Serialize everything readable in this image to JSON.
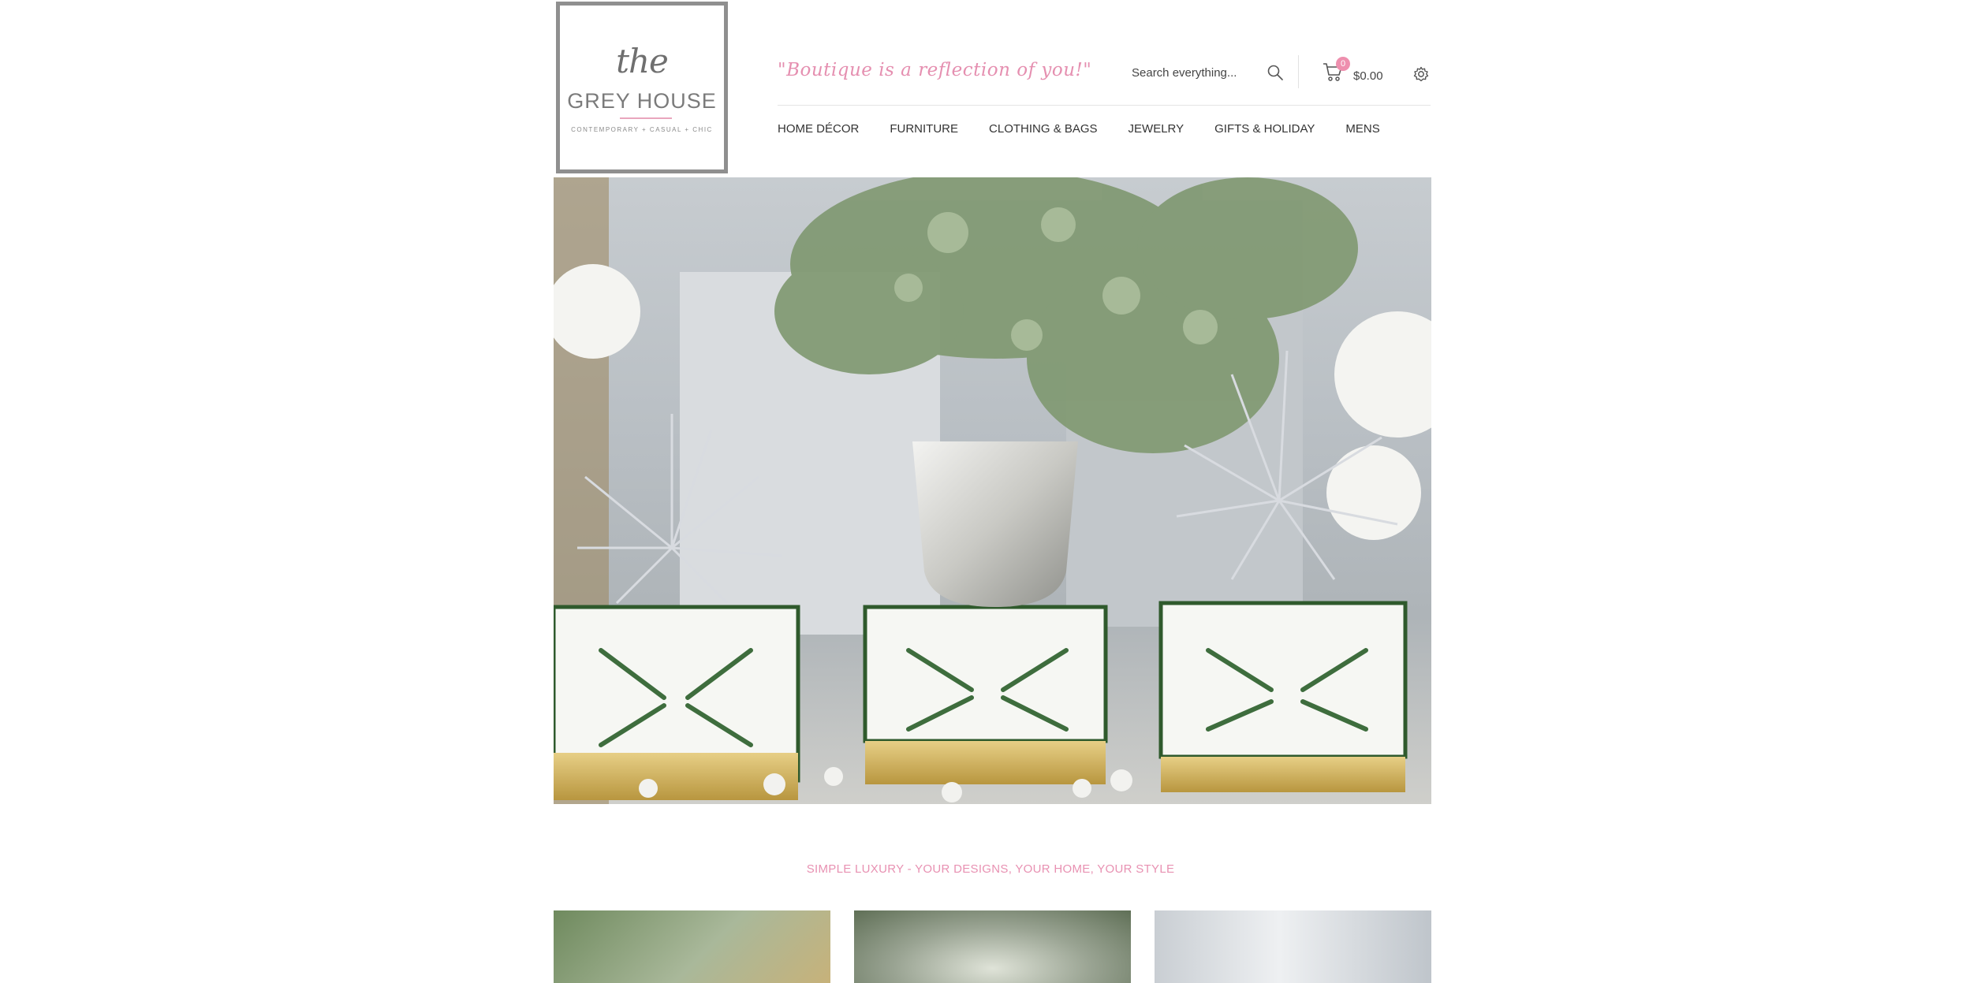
{
  "brand": {
    "the": "the",
    "name": "GREY HOUSE",
    "sub": "CONTEMPORARY + CASUAL + CHIC"
  },
  "tagline": "\"Boutique is a reflection of you!\"",
  "search": {
    "placeholder": "Search everything..."
  },
  "cart": {
    "count": "0",
    "total": "$0.00"
  },
  "nav": {
    "items": [
      "HOME DÉCOR",
      "FURNITURE",
      "CLOTHING & BAGS",
      "JEWELRY",
      "GIFTS & HOLIDAY",
      "MENS"
    ]
  },
  "strap": "SIMPLE LUXURY - YOUR DESIGNS, YOUR HOME, YOUR STYLE",
  "colors": {
    "accent": "#e58fb0",
    "badge": "#ee8fae",
    "text": "#333333"
  }
}
